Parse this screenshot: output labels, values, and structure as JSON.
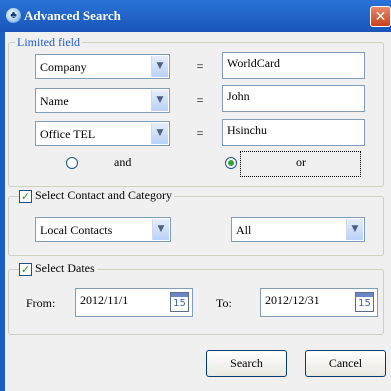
{
  "window": {
    "title": "Advanced Search",
    "close_glyph": "✕",
    "icon": "app-icon"
  },
  "limited_field": {
    "legend": "Limited field",
    "rows": [
      {
        "field": "Company",
        "operator": "=",
        "value": "WorldCard"
      },
      {
        "field": "Name",
        "operator": "=",
        "value": "John"
      },
      {
        "field": "Office TEL",
        "operator": "=",
        "value": "Hsinchu"
      }
    ],
    "logic": {
      "and_label": "and",
      "or_label": "or",
      "selected": "or"
    }
  },
  "contact_category": {
    "label": "Select Contact and Category",
    "checked": true,
    "contact_value": "Local Contacts",
    "category_value": "All"
  },
  "dates": {
    "label": "Select Dates",
    "checked": true,
    "from_label": "From:",
    "from_value": "2012/11/1",
    "to_label": "To:",
    "to_value": "2012/12/31",
    "calendar_day": "15"
  },
  "buttons": {
    "search": "Search",
    "cancel": "Cancel"
  }
}
